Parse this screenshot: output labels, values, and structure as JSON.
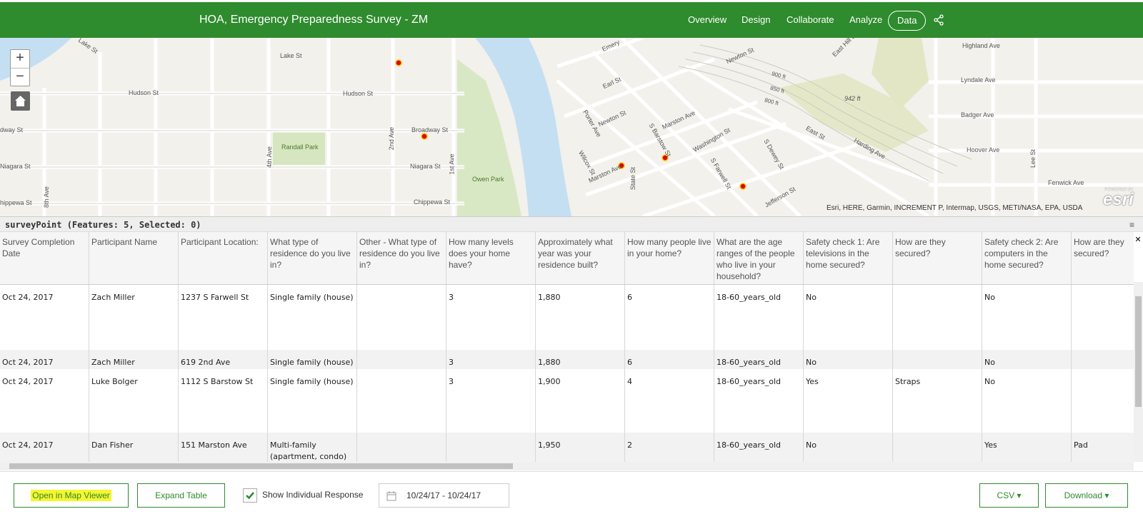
{
  "app": {
    "title": "HOA, Emergency Preparedness Survey - ZM",
    "nav": [
      "Overview",
      "Design",
      "Collaborate",
      "Analyze",
      "Data"
    ],
    "active_tab": "Data",
    "accent_color": "#2e8b2e"
  },
  "map": {
    "labels": [
      "Lake St",
      "Lake St",
      "Hudson St",
      "Hudson St",
      "dway St",
      "Broadway St",
      "Niagara St",
      "Niagara St",
      "hippewa St",
      "Chippewa St",
      "Randall Park",
      "Owen Park",
      "4th Ave",
      "2nd Ave",
      "1st Ave",
      "8th Ave",
      "Emery",
      "Earl St",
      "Porter Ave",
      "Newton St",
      "Newton St",
      "S Barstow St",
      "Marston Ave",
      "Marston Ave",
      "Wilcox St",
      "State St",
      "Washington St",
      "S Farwell St",
      "S Dewey St",
      "East St",
      "Harding Ave",
      "Jefferson St",
      "East Hill Dr",
      "Highland Ave",
      "Lyndale Ave",
      "Badger Ave",
      "Hoover Ave",
      "Lee St",
      "Fenwick Ave",
      "900 ft",
      "850 ft",
      "800 ft",
      "942 ft"
    ],
    "zoom_in": "+",
    "zoom_out": "−",
    "home_icon": "home-icon",
    "attribution": "Esri, HERE, Garmin, INCREMENT P, Intermap, USGS, METI/NASA, EPA, USDA",
    "logo": "esri",
    "powered_by": "POWERED BY",
    "point_color": "#e00000",
    "point_count": 5
  },
  "table": {
    "title": "surveyPoint (Features: 5, Selected: 0)",
    "menu_icon": "≡",
    "close_icon": "✕",
    "columns": [
      "Survey Completion Date",
      "Participant Name",
      "Participant Location:",
      "What type of residence do you live in?",
      "Other - What type of residence do you live in?",
      "How many levels does your home have?",
      "Approximately what year was your residence built?",
      "How many people live in your home?",
      "What are the age ranges of the people who live in your household?",
      "Safety check 1: Are televisions in the home secured?",
      "How are they secured?",
      "Safety check 2: Are computers in the home secured?",
      "How are they secured?"
    ],
    "rows": [
      [
        "Oct 24, 2017",
        "Zach Miller",
        "1237 S Farwell St",
        "Single family (house)",
        "",
        "3",
        "1,880",
        "6",
        "18-60_years_old",
        "No",
        "",
        "No",
        ""
      ],
      [
        "Oct 24, 2017",
        "Zach Miller",
        "619 2nd Ave",
        "Single family (house)",
        "",
        "3",
        "1,880",
        "6",
        "18-60_years_old",
        "No",
        "",
        "No",
        ""
      ],
      [
        "Oct 24, 2017",
        "Luke Bolger",
        "1112 S Barstow St",
        "Single family (house)",
        "",
        "3",
        "1,900",
        "4",
        "18-60_years_old",
        "Yes",
        "Straps",
        "No",
        ""
      ],
      [
        "Oct 24, 2017",
        "Dan Fisher",
        "151 Marston Ave",
        "Multi-family (apartment, condo)",
        "",
        "",
        "1,950",
        "2",
        "18-60_years_old",
        "No",
        "",
        "Yes",
        "Pad"
      ]
    ]
  },
  "toolbar": {
    "open_map_viewer": "Open in Map Viewer",
    "expand_table": "Expand Table",
    "show_individual": "Show Individual Response",
    "show_individual_checked": true,
    "date_range": "10/24/17 - 10/24/17",
    "csv": "CSV ▾",
    "download": "Download ▾"
  }
}
